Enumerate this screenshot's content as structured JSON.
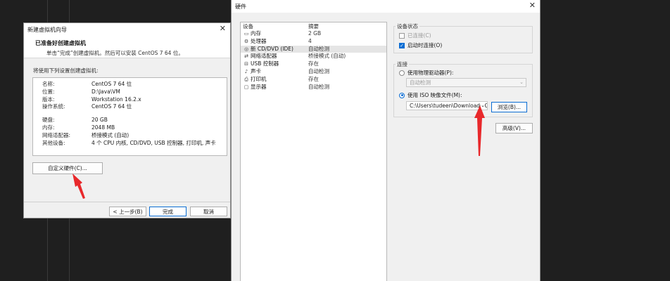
{
  "wizard": {
    "title": "新建虚拟机向导",
    "header_title": "已准备好创建虚拟机",
    "header_sub": "单击“完成”创建虚拟机。然后可以安装 CentOS 7 64 位。",
    "section_label": "将使用下列设置创建虚拟机:",
    "summary": [
      {
        "key": "名称:",
        "value": "CentOS 7 64 位"
      },
      {
        "key": "位置:",
        "value": "D:\\Java\\VM"
      },
      {
        "key": "版本:",
        "value": "Workstation 16.2.x"
      },
      {
        "key": "操作系统:",
        "value": "CentOS 7 64 位"
      },
      {
        "key": "硬盘:",
        "value": "20 GB"
      },
      {
        "key": "内存:",
        "value": "2048 MB"
      },
      {
        "key": "网络适配器:",
        "value": "桥接模式 (自动)"
      },
      {
        "key": "其他设备:",
        "value": "4 个 CPU 内核, CD/DVD, USB 控制器, 打印机, 声卡"
      }
    ],
    "customize_button": "自定义硬件(C)...",
    "back_button": "< 上一步(B)",
    "finish_button": "完成",
    "cancel_button": "取消"
  },
  "hardware": {
    "title": "硬件",
    "col_device": "设备",
    "col_summary": "摘要",
    "devices": [
      {
        "icon": "memory-icon",
        "glyph": "▭",
        "name": "内存",
        "summary": "2 GB"
      },
      {
        "icon": "processor-icon",
        "glyph": "⚙",
        "name": "处理器",
        "summary": "4"
      },
      {
        "icon": "cd-dvd-icon",
        "glyph": "◎",
        "name": "新 CD/DVD (IDE)",
        "summary": "自动检测"
      },
      {
        "icon": "network-adapter-icon",
        "glyph": "⇄",
        "name": "网络适配器",
        "summary": "桥接模式 (自动)"
      },
      {
        "icon": "usb-icon",
        "glyph": "⊟",
        "name": "USB 控制器",
        "summary": "存在"
      },
      {
        "icon": "sound-card-icon",
        "glyph": "♪",
        "name": "声卡",
        "summary": "自动检测"
      },
      {
        "icon": "printer-icon",
        "glyph": "⎙",
        "name": "打印机",
        "summary": "存在"
      },
      {
        "icon": "display-icon",
        "glyph": "▢",
        "name": "显示器",
        "summary": "自动检测"
      }
    ],
    "selected_index": 2,
    "device_status": {
      "label": "设备状态",
      "connected": "已连接(C)",
      "connect_on_power": "启动时连接(O)"
    },
    "connection": {
      "label": "连接",
      "physical_drive": "使用物理驱动器(P):",
      "physical_drive_value": "自动检测",
      "iso_image": "使用 ISO 映像文件(M):",
      "iso_path": "C:\\Users\\tudeen\\Downloads\\C",
      "browse_button": "浏览(B)...",
      "advanced_button": "高级(V)..."
    },
    "accent_color": "#0b6dd3",
    "arrow_color": "#e8282b"
  }
}
